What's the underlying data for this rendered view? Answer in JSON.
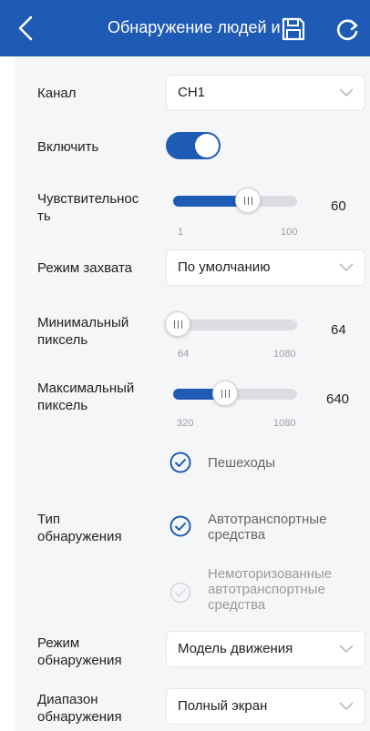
{
  "header": {
    "title": "Обнаружение людей и"
  },
  "channel": {
    "label": "Канал",
    "value": "CH1"
  },
  "enable": {
    "label": "Включить",
    "on": true
  },
  "sensitivity": {
    "label_l1": "Чувствительнос",
    "label_l2": "ть",
    "value": "60",
    "min": "1",
    "max": "100"
  },
  "capture_mode": {
    "label": "Режим захвата",
    "value": "По умолчанию"
  },
  "min_pixel": {
    "label_l1": "Минимальный",
    "label_l2": "пиксель",
    "value": "64",
    "min": "64",
    "max": "1080"
  },
  "max_pixel": {
    "label_l1": "Максимальный",
    "label_l2": "пиксель",
    "value": "640",
    "min": "320",
    "max": "1080"
  },
  "detection_type": {
    "label_l1": "Тип",
    "label_l2": "обнаружения",
    "options": [
      {
        "l1": "Пешеходы",
        "checked": true
      },
      {
        "l1": "Автотранспортные",
        "l2": "средства",
        "checked": true
      },
      {
        "l1": "Немоторизованные",
        "l2": "автотранспортные",
        "l3": "средства",
        "checked": false
      }
    ]
  },
  "detection_mode": {
    "label_l1": "Режим",
    "label_l2": "обнаружения",
    "value": "Модель движения"
  },
  "detection_range": {
    "label_l1": "Диапазон",
    "label_l2": "обнаружения",
    "value": "Полный экран"
  },
  "colors": {
    "accent": "#1f5bb4",
    "panel": "#f5f6f8",
    "track": "#dcdde1"
  }
}
